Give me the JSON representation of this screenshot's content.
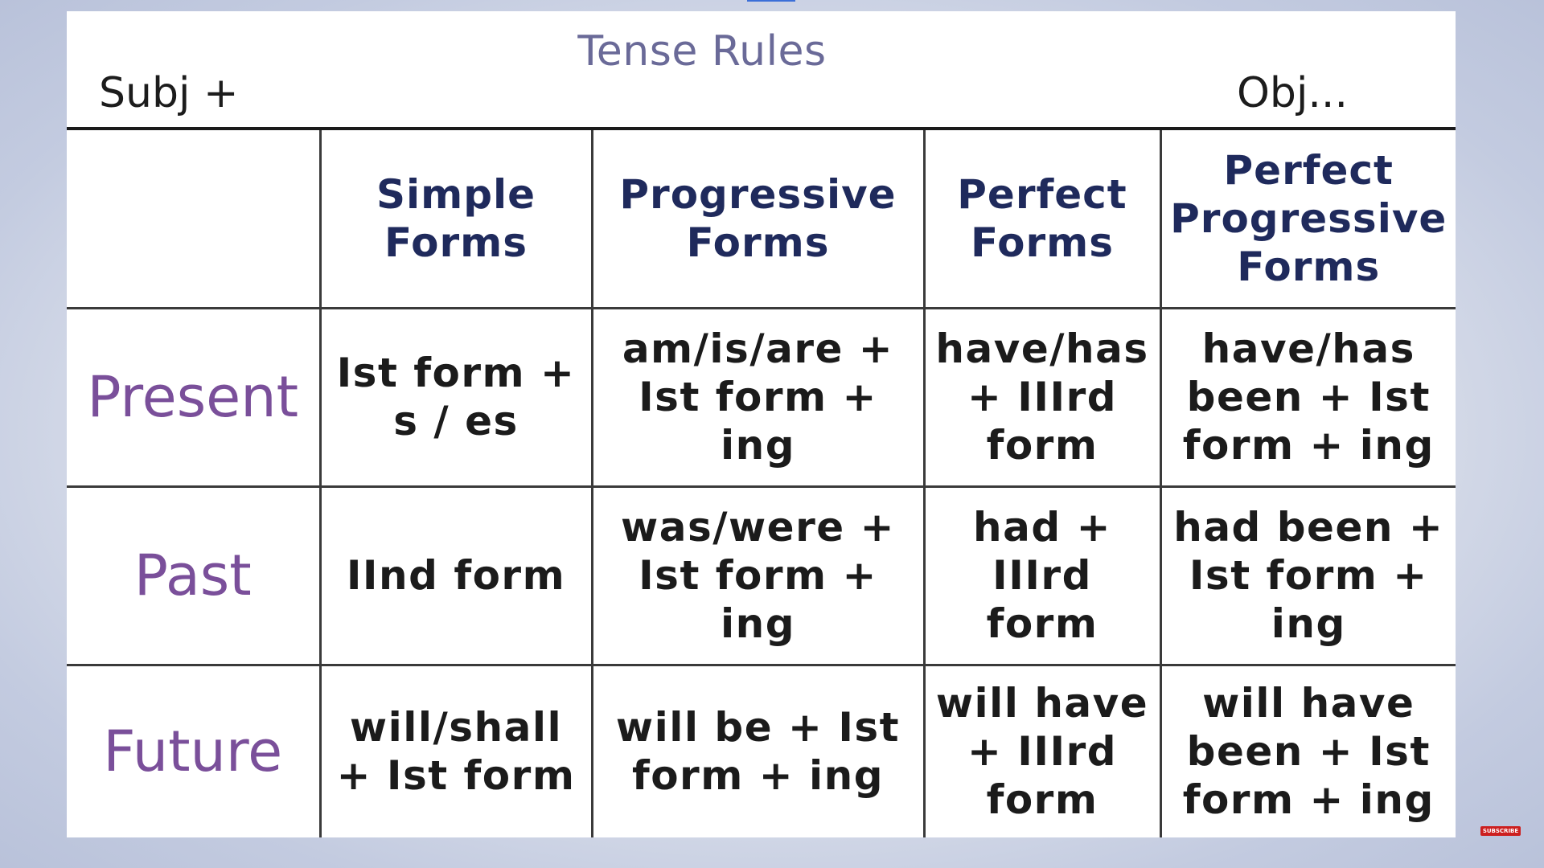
{
  "slide": {
    "title": "Tense Rules",
    "subject_label": "Subj +",
    "object_label": "Obj..."
  },
  "table": {
    "columns": [
      "",
      "Simple Forms",
      "Progressive Forms",
      "Perfect Forms",
      "Perfect Progressive Forms"
    ],
    "rows": [
      {
        "label": "Present",
        "cells": [
          "Ist form + s / es",
          "am/is/are + Ist form + ing",
          "have/has + IIIrd form",
          "have/has been + Ist form + ing"
        ]
      },
      {
        "label": "Past",
        "cells": [
          "IInd form",
          "was/were + Ist form + ing",
          "had + IIIrd form",
          "had been + Ist form + ing"
        ]
      },
      {
        "label": "Future",
        "cells": [
          "will/shall + Ist form",
          "will be + Ist form + ing",
          "will have + IIIrd form",
          "will have been + Ist form + ing"
        ]
      }
    ]
  },
  "overlay": {
    "subscribe_label": "SUBSCRIBE"
  },
  "colors": {
    "title": "#6a6a98",
    "column_header": "#1f2a5c",
    "row_header": "#7a4f9a",
    "cell_text": "#1b1b1b",
    "subscribe_badge": "#cc1f1f"
  }
}
